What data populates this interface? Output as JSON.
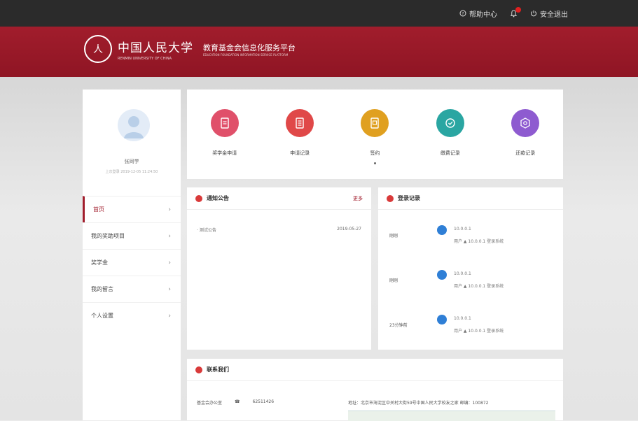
{
  "topbar": {
    "help_label": "帮助中心",
    "logout_label": "安全退出"
  },
  "header": {
    "university_name": "中国人民大学",
    "university_en": "RENMIN UNIVERSITY OF CHINA",
    "platform_name": "教育基金会信息化服务平台",
    "platform_en": "EDUCATION FOUNDATION INFORMATION SERVICE PLATFORM"
  },
  "user": {
    "name": "张同学",
    "last_login": "上次登录 2019-12-05 11:24:50"
  },
  "sidebar": {
    "items": [
      {
        "label": "首页",
        "active": true
      },
      {
        "label": "我的奖助项目",
        "active": false
      },
      {
        "label": "奖学金",
        "active": false
      },
      {
        "label": "我的留言",
        "active": false
      },
      {
        "label": "个人设置",
        "active": false
      }
    ]
  },
  "quick_actions": [
    {
      "label": "奖学金申请",
      "color": "#e0506a",
      "icon": "application-form-icon"
    },
    {
      "label": "申请记录",
      "color": "#e04848",
      "icon": "records-list-icon"
    },
    {
      "label": "签约",
      "color": "#e0a020",
      "icon": "contract-icon"
    },
    {
      "label": "缴费记录",
      "color": "#2aa6a2",
      "icon": "payment-icon"
    },
    {
      "label": "还款记录",
      "color": "#8e5bd0",
      "icon": "settings-gear-icon"
    }
  ],
  "notice": {
    "title": "通知公告",
    "more": "更多",
    "items": [
      {
        "title": "· 测试公告",
        "date": "2019-05-27"
      }
    ]
  },
  "login_log": {
    "title": "登录记录",
    "items": [
      {
        "time": "刚刚",
        "ip": "10.0.0.1",
        "text": "用户 ▲ 10.0.0.1 登录系统"
      },
      {
        "time": "刚刚",
        "ip": "10.0.0.1",
        "text": "用户 ▲ 10.0.0.1 登录系统"
      },
      {
        "time": "23分钟前",
        "ip": "10.0.0.1",
        "text": "用户 ▲ 10.0.0.1 登录系统"
      }
    ]
  },
  "contact": {
    "title": "联系我们",
    "dept": "基金会办公室",
    "phone": "62511426",
    "address": "地址：北京市海淀区中关村大街59号中国人民大学校友之家 邮编：100872"
  },
  "colors": {
    "brand": "#a11d2c",
    "topbar": "#2b2b2b"
  }
}
